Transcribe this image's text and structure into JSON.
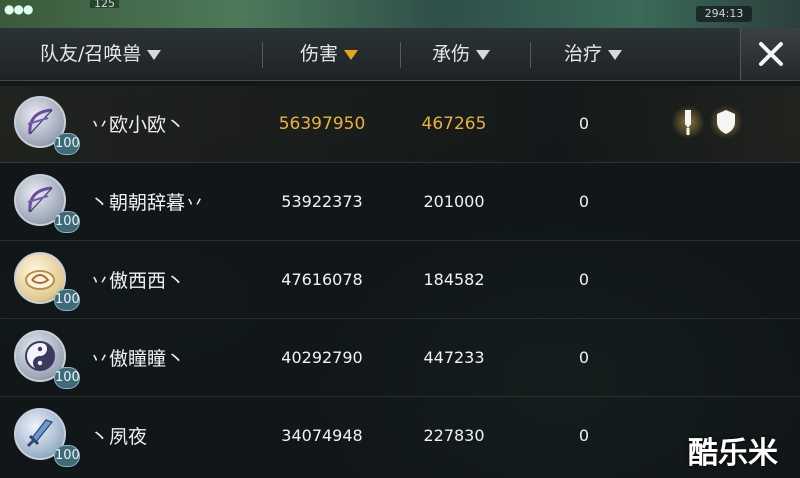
{
  "status": {
    "level": "125",
    "timer": "294:13"
  },
  "header": {
    "col_name": "队友/召唤兽",
    "col_damage": "伤害",
    "col_tank": "承伤",
    "col_heal": "治疗"
  },
  "rows": [
    {
      "name": "丷欧小欧丶",
      "level": "100",
      "damage": "56397950",
      "tank": "467265",
      "heal": "0",
      "icon": "bow-icon",
      "mvp": true
    },
    {
      "name": "丶朝朝辞暮丷",
      "level": "100",
      "damage": "53922373",
      "tank": "201000",
      "heal": "0",
      "icon": "bow-icon",
      "mvp": false
    },
    {
      "name": "丷傲西西丶",
      "level": "100",
      "damage": "47616078",
      "tank": "184582",
      "heal": "0",
      "icon": "cloud-icon",
      "mvp": false
    },
    {
      "name": "丷傲瞳瞳丶",
      "level": "100",
      "damage": "40292790",
      "tank": "447233",
      "heal": "0",
      "icon": "yin-yang-icon",
      "mvp": false
    },
    {
      "name": "丶夙夜",
      "level": "100",
      "damage": "34074948",
      "tank": "227830",
      "heal": "0",
      "icon": "sword-icon",
      "mvp": false
    }
  ],
  "colors": {
    "highlight_gold": "#e9b23a",
    "active_sort": "#e8a41c"
  },
  "watermark": "酷乐米"
}
